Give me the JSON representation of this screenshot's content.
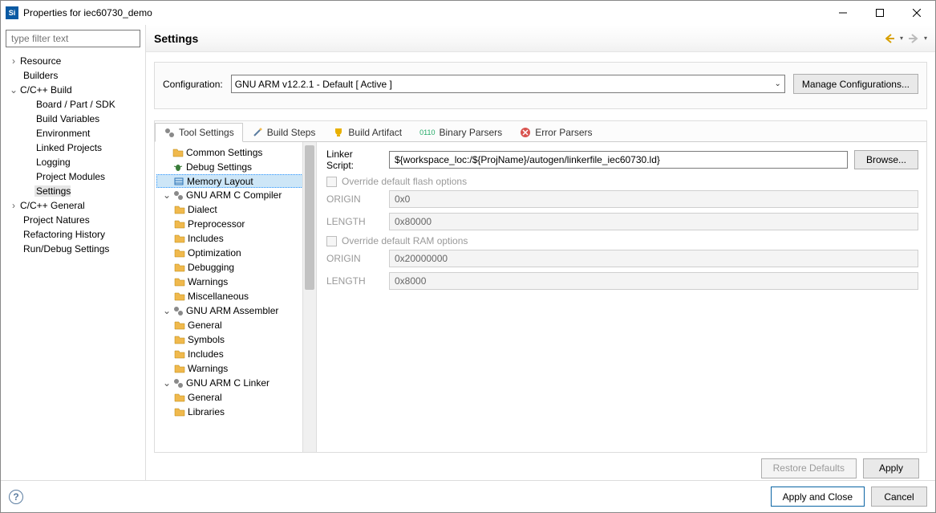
{
  "window": {
    "title": "Properties for iec60730_demo",
    "app_icon_text": "Si"
  },
  "filter": {
    "placeholder": "type filter text"
  },
  "nav": {
    "resource": "Resource",
    "builders": "Builders",
    "ccbuild": "C/C++ Build",
    "board": "Board / Part / SDK",
    "buildvars": "Build Variables",
    "environment": "Environment",
    "linked": "Linked Projects",
    "logging": "Logging",
    "projmod": "Project Modules",
    "settings": "Settings",
    "ccgeneral": "C/C++ General",
    "projnatures": "Project Natures",
    "refactor": "Refactoring History",
    "rundebug": "Run/Debug Settings"
  },
  "header": {
    "title": "Settings"
  },
  "config": {
    "label": "Configuration:",
    "value": "GNU ARM v12.2.1 - Default  [ Active ]",
    "manage": "Manage Configurations..."
  },
  "tabs": {
    "tool": "Tool Settings",
    "steps": "Build Steps",
    "artifact": "Build Artifact",
    "binary": "Binary Parsers",
    "error": "Error Parsers"
  },
  "tooltree": {
    "common": "Common Settings",
    "debugset": "Debug Settings",
    "memlayout": "Memory Layout",
    "compiler": "GNU ARM C Compiler",
    "dialect": "Dialect",
    "preproc": "Preprocessor",
    "includes": "Includes",
    "optim": "Optimization",
    "debug": "Debugging",
    "warn": "Warnings",
    "misc": "Miscellaneous",
    "assembler": "GNU ARM Assembler",
    "general": "General",
    "symbols": "Symbols",
    "includes2": "Includes",
    "warn2": "Warnings",
    "linker": "GNU ARM C Linker",
    "general2": "General",
    "libs": "Libraries"
  },
  "form": {
    "linker_label": "Linker Script:",
    "linker_value": "${workspace_loc:/${ProjName}/autogen/linkerfile_iec60730.ld}",
    "browse": "Browse...",
    "override_flash": "Override default flash options",
    "origin_label": "ORIGIN",
    "length_label": "LENGTH",
    "flash_origin": "0x0",
    "flash_length": "0x80000",
    "override_ram": "Override default RAM options",
    "ram_origin": "0x20000000",
    "ram_length": "0x8000"
  },
  "buttons": {
    "restore": "Restore Defaults",
    "apply": "Apply",
    "applyclose": "Apply and Close",
    "cancel": "Cancel"
  }
}
